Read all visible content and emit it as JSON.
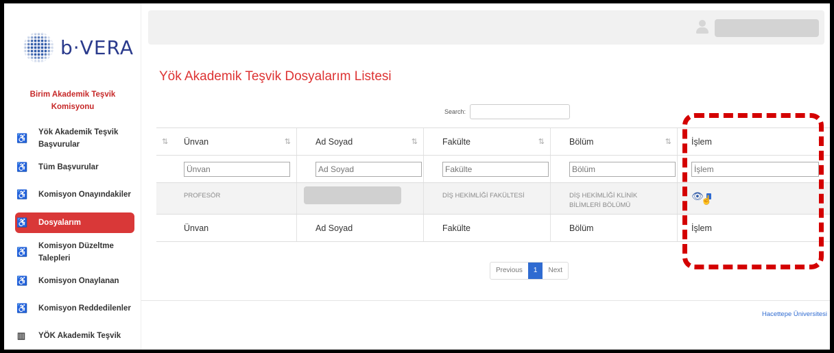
{
  "brand": {
    "logo_text": "b·VERA"
  },
  "sidebar": {
    "role": "Birim Akademik Teşvik Komisyonu",
    "items": [
      {
        "label": "Yök Akademik Teşvik Başvurular",
        "icon": "stroller-icon",
        "active": false
      },
      {
        "label": "Tüm Başvurular",
        "icon": "stroller-icon",
        "active": false
      },
      {
        "label": "Komisyon Onayındakiler",
        "icon": "stroller-icon",
        "active": false
      },
      {
        "label": "Dosyalarım",
        "icon": "stroller-icon",
        "active": true
      },
      {
        "label": "Komisyon Düzeltme Talepleri",
        "icon": "stroller-icon",
        "active": false
      },
      {
        "label": "Komisyon Onaylanan",
        "icon": "stroller-icon",
        "active": false
      },
      {
        "label": "Komisyon Reddedilenler",
        "icon": "stroller-icon",
        "active": false
      },
      {
        "label": "YÖK Akademik Teşvik",
        "icon": "chart-icon",
        "active": false
      }
    ]
  },
  "page": {
    "title": "Yök Akademik Teşvik Dosyalarım Listesi"
  },
  "search": {
    "label": "Search:",
    "value": ""
  },
  "table": {
    "columns": [
      "Ünvan",
      "Ad Soyad",
      "Fakülte",
      "Bölüm",
      "İşlem"
    ],
    "filters": [
      "Ünvan",
      "Ad Soyad",
      "Fakülte",
      "Bölüm",
      "İşlem"
    ],
    "rows": [
      {
        "unvan": "PROFESÖR",
        "ad_soyad": "",
        "fakulte": "DİŞ HEKİMLİĞİ FAKÜLTESİ",
        "bolum": "DİŞ HEKİMLİĞİ KLİNİK BİLİMLERİ BÖLÜMÜ"
      }
    ],
    "footer": [
      "Ünvan",
      "Ad Soyad",
      "Fakülte",
      "Bölüm",
      "İşlem"
    ]
  },
  "pagination": {
    "previous": "Previous",
    "page": "1",
    "next": "Next"
  },
  "footer": {
    "link": "Hacettepe Üniversitesi"
  },
  "colors": {
    "accent": "#d93838",
    "link": "#2f6bd1",
    "highlight": "#d40000"
  }
}
